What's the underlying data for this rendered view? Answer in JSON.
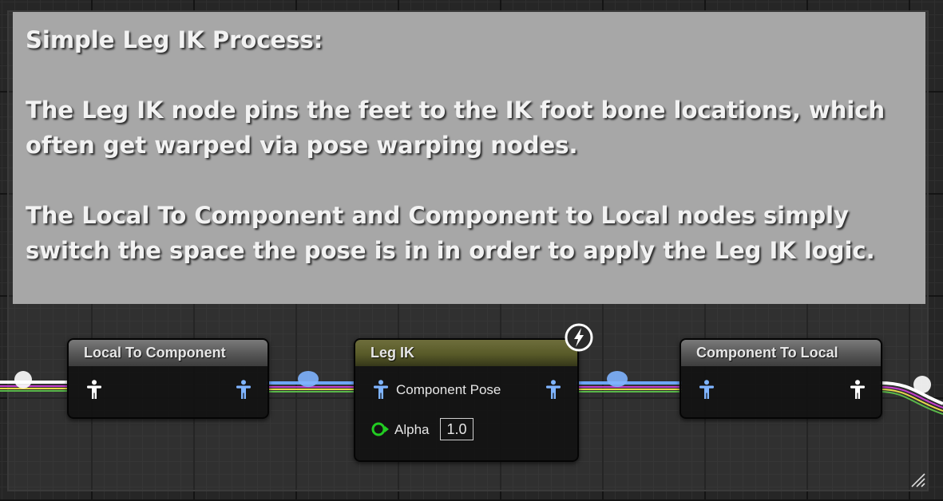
{
  "comment": {
    "lines": [
      "Simple Leg IK Process:",
      "The Leg IK node pins the feet to the IK foot bone locations, which",
      "often get warped via pose warping nodes.",
      "The Local To Component and Component to Local nodes simply",
      "switch the space the pose is in in order to apply the Leg IK logic."
    ]
  },
  "nodes": {
    "local_to_component": {
      "title": "Local To Component"
    },
    "leg_ik": {
      "title": "Leg IK",
      "pose_pin_label": "Component Pose",
      "alpha_label": "Alpha",
      "alpha_value": "1.0"
    },
    "component_to_local": {
      "title": "Component To Local"
    }
  },
  "icons": {
    "local_pose_pin": "person-white-icon",
    "component_pose_pin": "person-blue-icon",
    "float_pin": "green-circle-pin-icon",
    "fast_path": "lightning-bolt-icon",
    "resize": "resize-grip-icon"
  },
  "colors": {
    "comment_bg": "#a7a7a7",
    "local_wire": "#ffffff",
    "component_wire": "#6da7ff",
    "leg_ik_title": "#585a28",
    "alpha_pin": "#22cc22"
  }
}
